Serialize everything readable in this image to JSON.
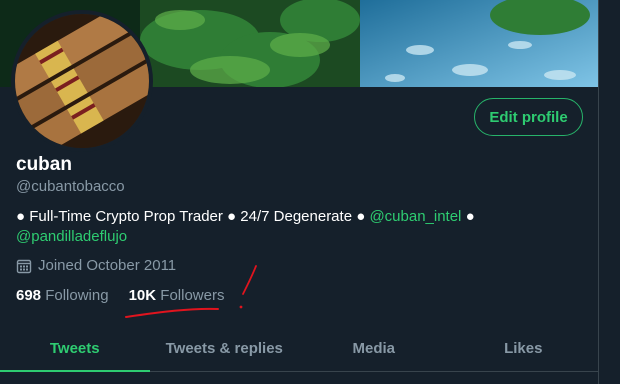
{
  "profile": {
    "name": "cuban",
    "handle": "@cubantobacco",
    "edit_label": "Edit profile",
    "bio": {
      "part1": "● Full-Time Crypto Prop Trader ● 24/7 Degenerate ● ",
      "mention1": "@cuban_intel",
      "part2": " ●",
      "mention2": "@pandilladeflujo"
    },
    "joined": "Joined October 2011",
    "following_count": "698",
    "following_label": "Following",
    "followers_count": "10K",
    "followers_label": "Followers"
  },
  "tabs": [
    {
      "label": "Tweets"
    },
    {
      "label": "Tweets & replies"
    },
    {
      "label": "Media"
    },
    {
      "label": "Likes"
    }
  ],
  "colors": {
    "accent": "#2ecc71",
    "background": "#15202b",
    "muted": "#8899a6",
    "annotation": "#e0141e"
  },
  "icons": {
    "joined": "calendar-icon"
  }
}
